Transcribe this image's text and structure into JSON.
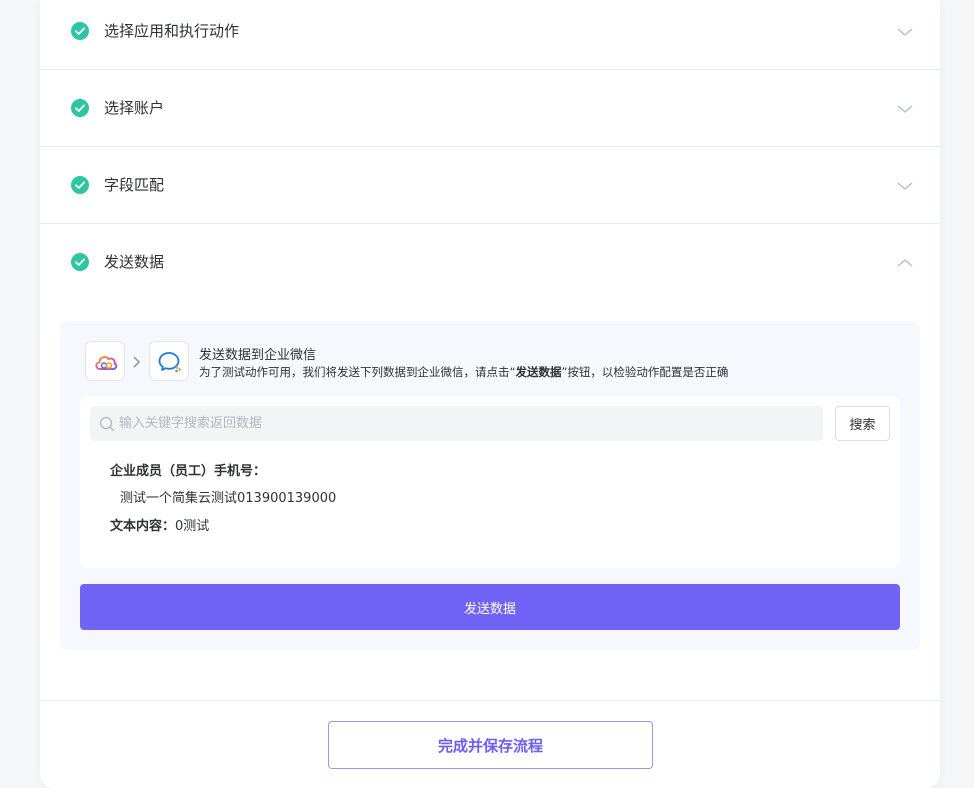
{
  "steps": [
    {
      "title": "选择应用和执行动作",
      "state": "collapsed"
    },
    {
      "title": "选择账户",
      "state": "collapsed"
    },
    {
      "title": "字段匹配",
      "state": "collapsed"
    },
    {
      "title": "发送数据",
      "state": "expanded"
    }
  ],
  "send_panel": {
    "title": "发送数据到企业微信",
    "desc_prefix": "为了测试动作可用，我们将发送下列数据到企业微信，请点击“",
    "desc_bold": "发送数据",
    "desc_suffix": "”按钮，以检验动作配置是否正确",
    "search": {
      "placeholder": "输入关键字搜索返回数据",
      "value": "",
      "button_label": "搜索"
    },
    "fields": [
      {
        "label": "企业成员（员工）手机号：",
        "value": "测试一个简集云测试013900139000"
      },
      {
        "label": "文本内容：",
        "value": "0测试"
      }
    ],
    "send_button_label": "发送数据"
  },
  "footer": {
    "save_button_label": "完成并保存流程"
  },
  "colors": {
    "accent": "#7063f6",
    "success": "#2ec5a3",
    "panel_bg": "#f7f7fe"
  }
}
